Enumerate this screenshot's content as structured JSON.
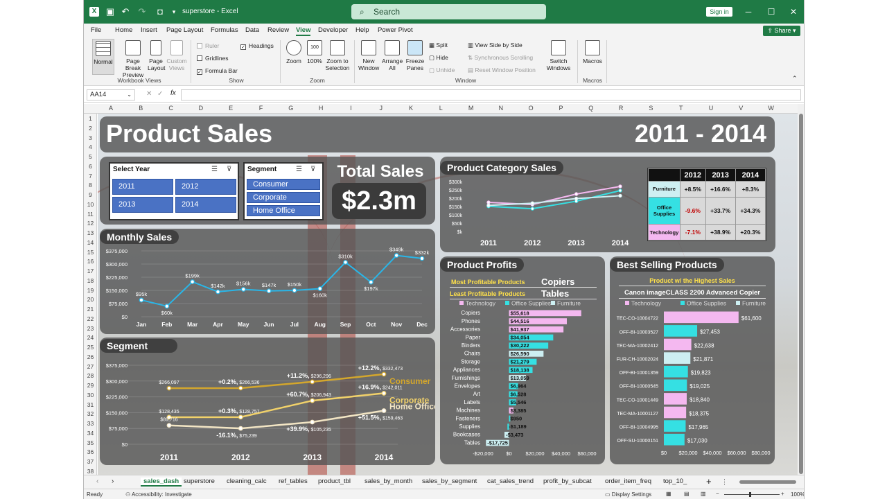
{
  "window": {
    "title": "superstore - Excel",
    "search_placeholder": "Search",
    "sign_in": "Sign in",
    "share": "Share"
  },
  "menu": [
    "File",
    "Home",
    "Insert",
    "Page Layout",
    "Formulas",
    "Data",
    "Review",
    "View",
    "Developer",
    "Help",
    "Power Pivot"
  ],
  "active_menu": "View",
  "ribbon": {
    "workbook_views": {
      "label": "Workbook Views",
      "items": [
        "Normal",
        "Page Break Preview",
        "Page Layout",
        "Custom Views"
      ]
    },
    "show": {
      "label": "Show",
      "items": [
        {
          "label": "Ruler",
          "checked": false,
          "enabled": false
        },
        {
          "label": "Headings",
          "checked": true,
          "enabled": true
        },
        {
          "label": "Gridlines",
          "checked": false,
          "enabled": true
        },
        {
          "label": "Formula Bar",
          "checked": true,
          "enabled": true
        }
      ]
    },
    "zoom": {
      "label": "Zoom",
      "items": [
        "Zoom",
        "100%",
        "Zoom to Selection"
      ]
    },
    "window_grp": {
      "label": "Window",
      "items": [
        "New Window",
        "Arrange All",
        "Freeze Panes"
      ],
      "small": [
        "Split",
        "Hide",
        "Unhide",
        "View Side by Side",
        "Synchronous Scrolling",
        "Reset Window Position"
      ]
    },
    "switch": "Switch Windows",
    "macros": {
      "label": "Macros",
      "item": "Macros"
    }
  },
  "formula_bar": {
    "name_box": "AA14",
    "fx": "fx",
    "value": ""
  },
  "columns": [
    "A",
    "B",
    "C",
    "D",
    "E",
    "F",
    "G",
    "H",
    "I",
    "J",
    "K",
    "L",
    "M",
    "N",
    "O",
    "P",
    "Q",
    "R",
    "S",
    "T",
    "U",
    "V",
    "W"
  ],
  "rows": [
    "1",
    "2",
    "3",
    "4",
    "5",
    "6",
    "7",
    "8",
    "9",
    "10",
    "11",
    "12",
    "13",
    "14",
    "15",
    "16",
    "17",
    "18",
    "19",
    "20",
    "21",
    "22",
    "23",
    "24",
    "25",
    "26",
    "27",
    "28",
    "29",
    "30",
    "31",
    "32",
    "33",
    "34",
    "35",
    "36",
    "37",
    "38"
  ],
  "dashboard": {
    "title": "Product Sales",
    "years": "2011 - 2014",
    "slicer_year": {
      "title": "Select Year",
      "items": [
        "2011",
        "2012",
        "2013",
        "2014"
      ]
    },
    "slicer_segment": {
      "title": "Segment",
      "items": [
        "Consumer",
        "Corporate",
        "Home Office"
      ]
    },
    "total_sales_label": "Total Sales",
    "total_sales_value": "$2.3m",
    "monthly_title": "Monthly Sales",
    "segment_title": "Segment",
    "category_title": "Product Category Sales",
    "profits_title": "Product Profits",
    "best_title": "Best Selling Products",
    "most_label": "Most Profitable Products",
    "most_value": "Copiers",
    "least_label": "Least Profitable Products",
    "least_value": "Tables",
    "highest_label": "Product w/ the Highest Sales",
    "highest_value": "Canon imageCLASS 2200 Advanced Copier"
  },
  "colors": {
    "technology": "#f4b8f0",
    "office_supplies": "#35e0e3",
    "furniture": "#cdeff2",
    "consumer": "#d4a72c",
    "corporate": "#f2d26a",
    "home_office": "#f2e5c4",
    "line": "#29b6e8"
  },
  "chart_data": [
    {
      "type": "line",
      "id": "monthly",
      "categories": [
        "Jan",
        "Feb",
        "Mar",
        "Apr",
        "May",
        "Jun",
        "Jul",
        "Aug",
        "Sep",
        "Oct",
        "Nov",
        "Dec"
      ],
      "values": [
        95,
        60,
        199,
        142,
        156,
        147,
        150,
        160,
        310,
        197,
        349,
        332
      ],
      "labels": [
        "$95k",
        "$60k",
        "$199k",
        "$142k",
        "$156k",
        "$147k",
        "$150k",
        "$160k",
        "$310k",
        "$197k",
        "$349k",
        "$332k"
      ],
      "yticks": [
        "$0",
        "$75,000",
        "$150,000",
        "$225,000",
        "$300,000",
        "$375,000"
      ],
      "ylim": [
        0,
        375
      ]
    },
    {
      "type": "line",
      "id": "segment",
      "categories": [
        "2011",
        "2012",
        "2013",
        "2014"
      ],
      "yticks": [
        "$0",
        "$75,000",
        "$150,000",
        "$225,000",
        "$300,000",
        "$375,000"
      ],
      "ylim": [
        0,
        375
      ],
      "series": [
        {
          "name": "Consumer",
          "values": [
            266.097,
            266.536,
            296.296,
            332.473
          ],
          "labels": [
            "$266,097",
            "$266,536",
            "$296,296",
            "$332,473"
          ],
          "growth": [
            "",
            "+0.2%,",
            "+11.2%,",
            "+12.2%,"
          ]
        },
        {
          "name": "Corporate",
          "values": [
            128.435,
            128.757,
            206.943,
            242.011
          ],
          "labels": [
            "$128,435",
            "$128,757",
            "$206,943",
            "$242,011"
          ],
          "growth": [
            "",
            "+0.3%,",
            "+60.7%,",
            "+16.9%,"
          ]
        },
        {
          "name": "Home Office",
          "values": [
            89.716,
            75.239,
            105.235,
            159.463
          ],
          "labels": [
            "$89,716",
            "$75,239",
            "$105,235",
            "$159,463"
          ],
          "growth": [
            "",
            "-16.1%,",
            "+39.9%,",
            "+51.5%,"
          ]
        }
      ]
    },
    {
      "type": "line",
      "id": "category",
      "categories": [
        "2011",
        "2012",
        "2013",
        "2014"
      ],
      "yticks": [
        "$k",
        "$50k",
        "$100k",
        "$150k",
        "$200k",
        "$250k",
        "$300k"
      ],
      "ylim": [
        0,
        300
      ],
      "series": [
        {
          "name": "Technology",
          "values": [
            175,
            162,
            225,
            271
          ]
        },
        {
          "name": "Office Supplies",
          "values": [
            151,
            137,
            182,
            246
          ]
        },
        {
          "name": "Furniture",
          "values": [
            157,
            170,
            198,
            215
          ]
        }
      ]
    },
    {
      "type": "table",
      "id": "category_growth",
      "columns": [
        "2012",
        "2013",
        "2014"
      ],
      "rows": [
        {
          "name": "Furniture",
          "values": [
            "+8.5%",
            "+16.6%",
            "+8.3%"
          ]
        },
        {
          "name": "Office Supplies",
          "values": [
            "-9.6%",
            "+33.7%",
            "+34.3%"
          ]
        },
        {
          "name": "Technology",
          "values": [
            "-7.1%",
            "+38.9%",
            "+20.3%"
          ]
        }
      ]
    },
    {
      "type": "bar",
      "id": "profits",
      "legend": [
        "Technology",
        "Office Supplies",
        "Furniture"
      ],
      "categories": [
        "Copiers",
        "Phones",
        "Accessories",
        "Paper",
        "Binders",
        "Chairs",
        "Storage",
        "Appliances",
        "Furnishings",
        "Envelopes",
        "Art",
        "Labels",
        "Machines",
        "Fasteners",
        "Supplies",
        "Bookcases",
        "Tables"
      ],
      "values": [
        55618,
        44516,
        41937,
        34054,
        30222,
        26590,
        21279,
        18138,
        13059,
        6964,
        6528,
        5546,
        3385,
        950,
        -1189,
        -3473,
        -17725
      ],
      "labels": [
        "$55,618",
        "$44,516",
        "$41,937",
        "$34,054",
        "$30,222",
        "$26,590",
        "$21,279",
        "$18,138",
        "$13,059",
        "$6,964",
        "$6,528",
        "$5,546",
        "$3,385",
        "$950",
        "-$1,189",
        "-$3,473",
        "-$17,725"
      ],
      "group": [
        "technology",
        "technology",
        "technology",
        "office_supplies",
        "office_supplies",
        "furniture",
        "office_supplies",
        "office_supplies",
        "furniture",
        "office_supplies",
        "office_supplies",
        "office_supplies",
        "technology",
        "office_supplies",
        "office_supplies",
        "furniture",
        "furniture"
      ],
      "xticks": [
        "-$20,000",
        "$0",
        "$20,000",
        "$40,000",
        "$60,000"
      ],
      "xlim": [
        -20000,
        60000
      ]
    },
    {
      "type": "bar",
      "id": "best",
      "legend": [
        "Technology",
        "Office Supplies",
        "Furniture"
      ],
      "categories": [
        "TEC-CO-10004722",
        "OFF-BI-10003527",
        "TEC-MA-10002412",
        "FUR-CH-10002024",
        "OFF-BI-10001359",
        "OFF-BI-10000545",
        "TEC-CO-10001449",
        "TEC-MA-10001127",
        "OFF-BI-10004995",
        "OFF-SU-10000151"
      ],
      "values": [
        61600,
        27453,
        22638,
        21871,
        19823,
        19025,
        18840,
        18375,
        17965,
        17030
      ],
      "labels": [
        "$61,600",
        "$27,453",
        "$22,638",
        "$21,871",
        "$19,823",
        "$19,025",
        "$18,840",
        "$18,375",
        "$17,965",
        "$17,030"
      ],
      "group": [
        "technology",
        "office_supplies",
        "technology",
        "furniture",
        "office_supplies",
        "office_supplies",
        "technology",
        "technology",
        "office_supplies",
        "office_supplies"
      ],
      "xticks": [
        "$0",
        "$20,000",
        "$40,000",
        "$60,000",
        "$80,000"
      ],
      "xlim": [
        0,
        80000
      ]
    }
  ],
  "sheet_tabs": [
    "sales_dash",
    "superstore",
    "cleaning_calc",
    "ref_tables",
    "product_tbl",
    "sales_by_month",
    "sales_by_segment",
    "cat_sales_trend",
    "profit_by_subcat",
    "order_item_freq",
    "top_10_"
  ],
  "status": {
    "ready": "Ready",
    "accessibility": "Accessibility: Investigate",
    "display": "Display Settings",
    "zoom": "100%"
  }
}
